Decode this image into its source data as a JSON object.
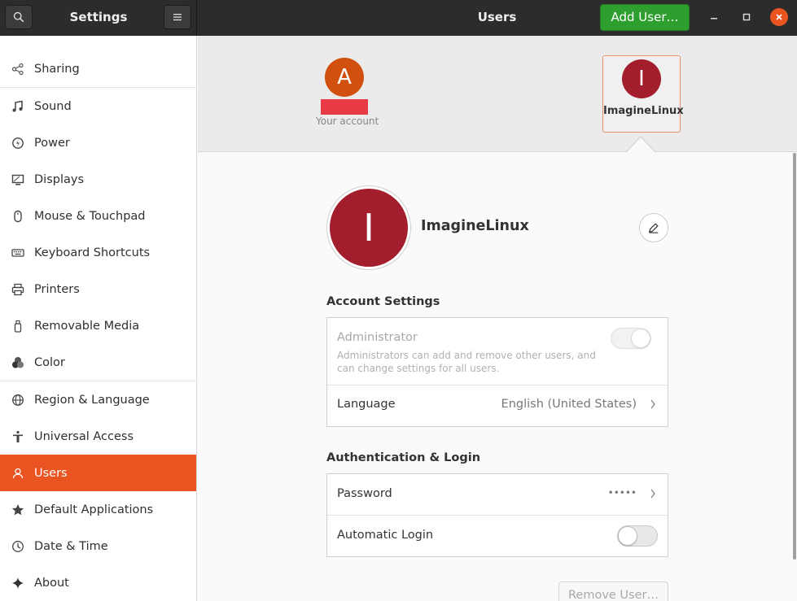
{
  "header": {
    "settings_title": "Settings",
    "panel_title": "Users",
    "add_user_label": "Add User…"
  },
  "sidebar": {
    "items": [
      {
        "label": "Sharing",
        "icon": "share-icon"
      },
      {
        "label": "Sound",
        "icon": "music-note-icon"
      },
      {
        "label": "Power",
        "icon": "power-icon"
      },
      {
        "label": "Displays",
        "icon": "display-icon"
      },
      {
        "label": "Mouse & Touchpad",
        "icon": "mouse-icon"
      },
      {
        "label": "Keyboard Shortcuts",
        "icon": "keyboard-icon"
      },
      {
        "label": "Printers",
        "icon": "printer-icon"
      },
      {
        "label": "Removable Media",
        "icon": "usb-drive-icon"
      },
      {
        "label": "Color",
        "icon": "color-icon"
      },
      {
        "label": "Region & Language",
        "icon": "globe-icon"
      },
      {
        "label": "Universal Access",
        "icon": "accessibility-icon"
      },
      {
        "label": "Users",
        "icon": "users-icon",
        "selected": true
      },
      {
        "label": "Default Applications",
        "icon": "star-icon"
      },
      {
        "label": "Date & Time",
        "icon": "clock-icon"
      },
      {
        "label": "About",
        "icon": "sparkle-icon"
      }
    ]
  },
  "users": {
    "your_account": {
      "initial": "A",
      "caption": "Your account"
    },
    "selected": {
      "initial": "I",
      "name": "ImagineLinux"
    }
  },
  "profile": {
    "initial": "I",
    "name": "ImagineLinux"
  },
  "account_settings": {
    "title": "Account Settings",
    "administrator_label": "Administrator",
    "administrator_desc": "Administrators can add and remove other users, and can change settings for all users.",
    "administrator_enabled": false,
    "language_label": "Language",
    "language_value": "English (United States)"
  },
  "auth": {
    "title": "Authentication & Login",
    "password_label": "Password",
    "password_value": "•••••",
    "autologin_label": "Automatic Login",
    "autologin_enabled": false
  },
  "remove_user_label": "Remove User…",
  "colors": {
    "accent": "#e95420",
    "add_user_green": "#2e9e2e",
    "avatar_a": "#d2500e",
    "avatar_i": "#a31e2d"
  }
}
